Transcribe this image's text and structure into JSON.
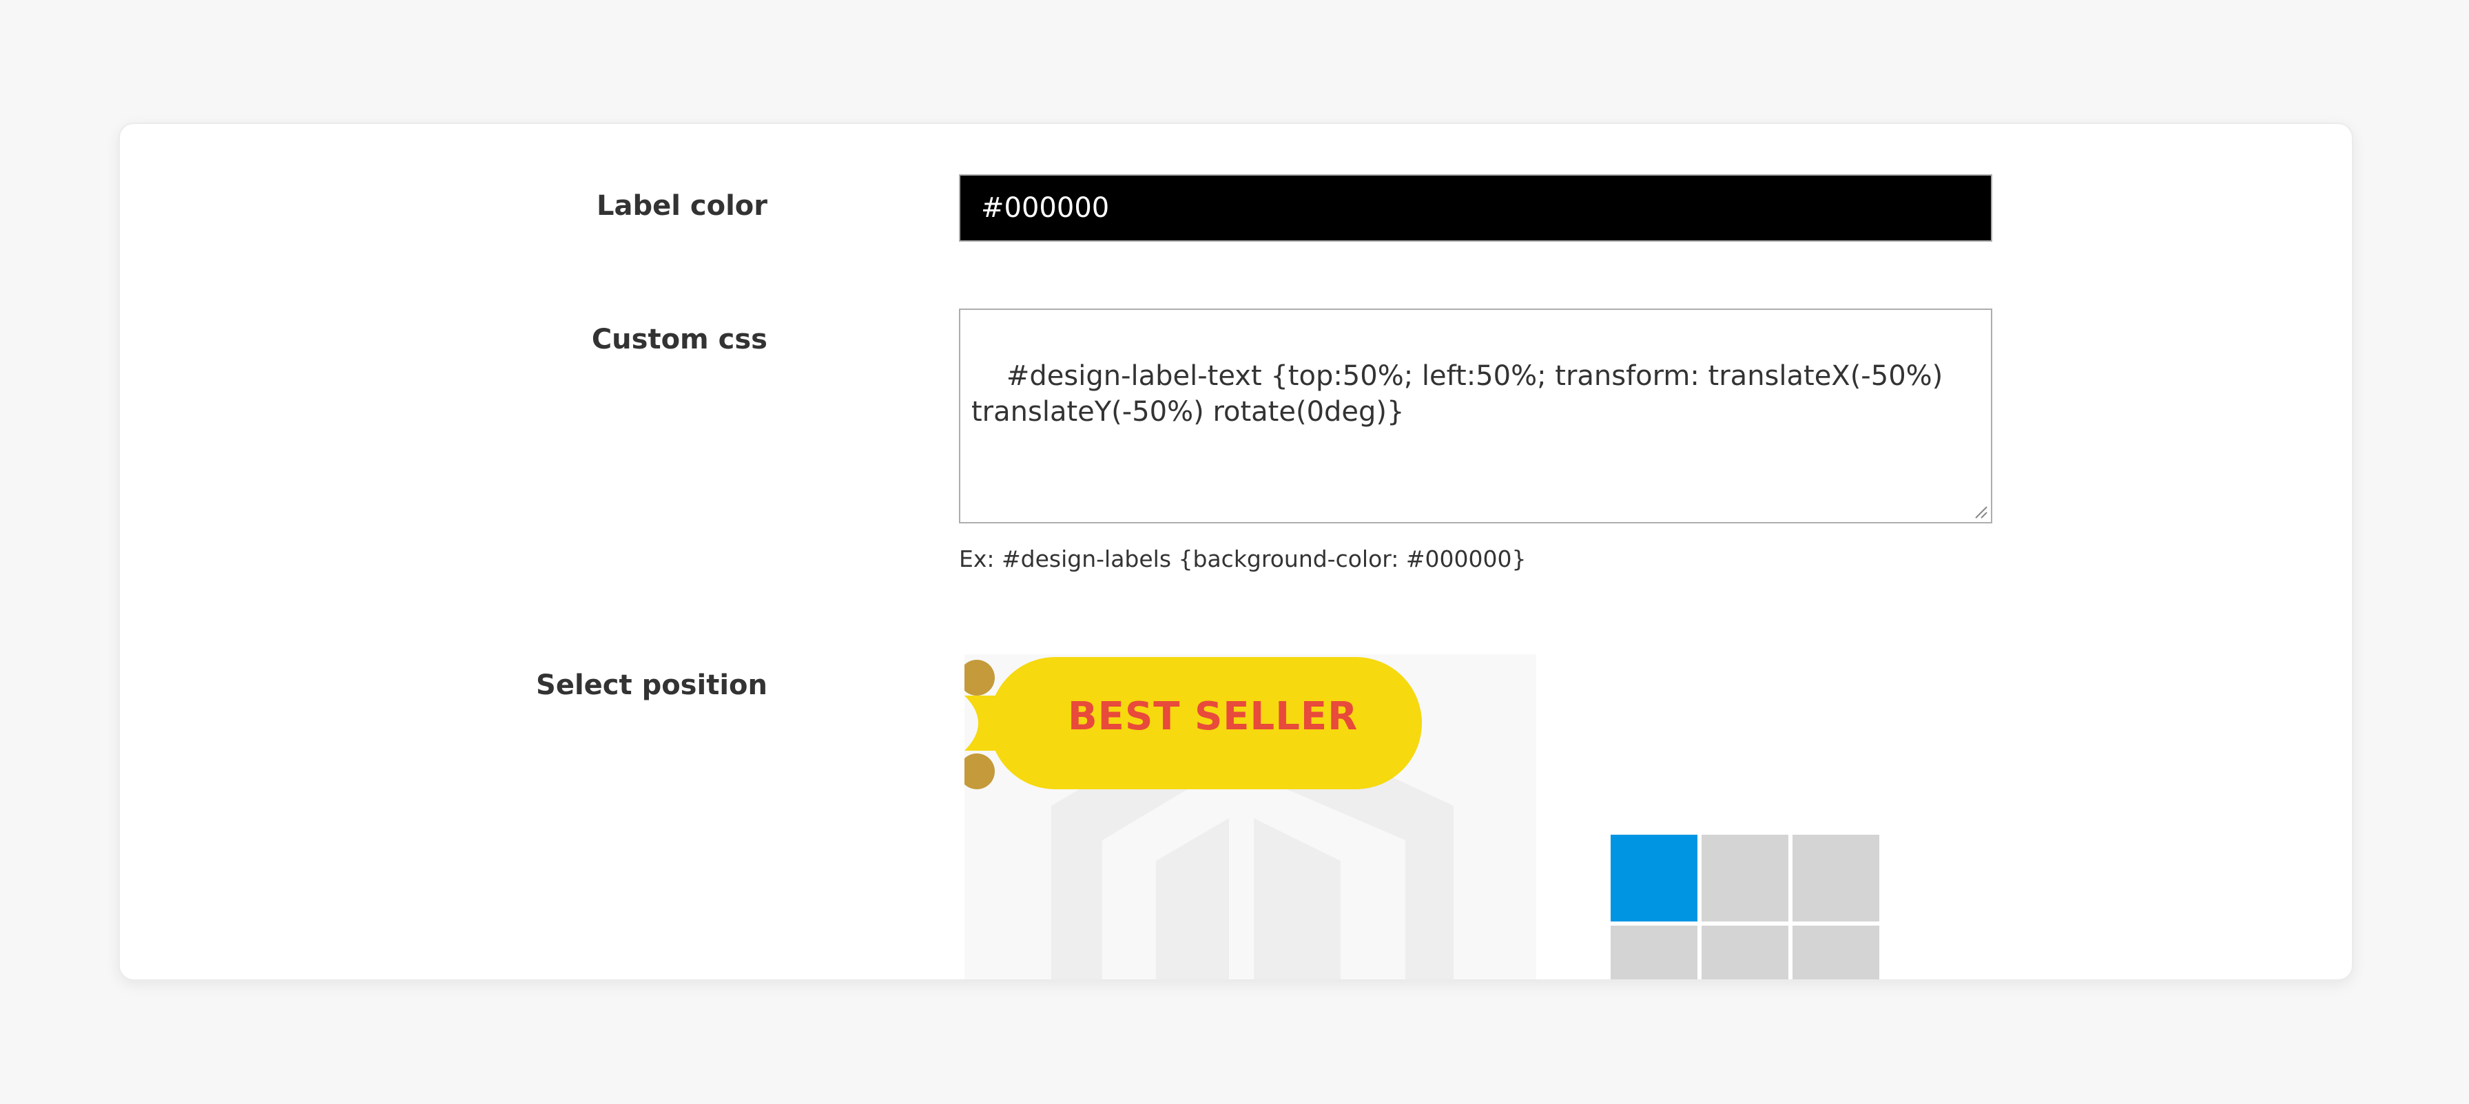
{
  "form": {
    "label_color": {
      "label": "Label color",
      "value": "#000000"
    },
    "custom_css": {
      "label": "Custom css",
      "value": "#design-label-text {top:50%; left:50%; transform: translateX(-50%)\ntranslateY(-50%) rotate(0deg)}",
      "hint": "Ex: #design-labels {background-color: #000000}"
    },
    "select_position": {
      "label": "Select position",
      "badge_text": "BEST SELLER",
      "selected_index": 0,
      "cells": [
        "top-left",
        "top-center",
        "top-right",
        "middle-left",
        "middle-center",
        "middle-right"
      ]
    }
  },
  "colors": {
    "page_bg": "#f7f7f7",
    "badge_yellow": "#f6d90f",
    "badge_text": "#e84a3b",
    "badge_ring": "#c49a3a",
    "selected_cell": "#0095e2",
    "cell": "#d4d4d4"
  }
}
